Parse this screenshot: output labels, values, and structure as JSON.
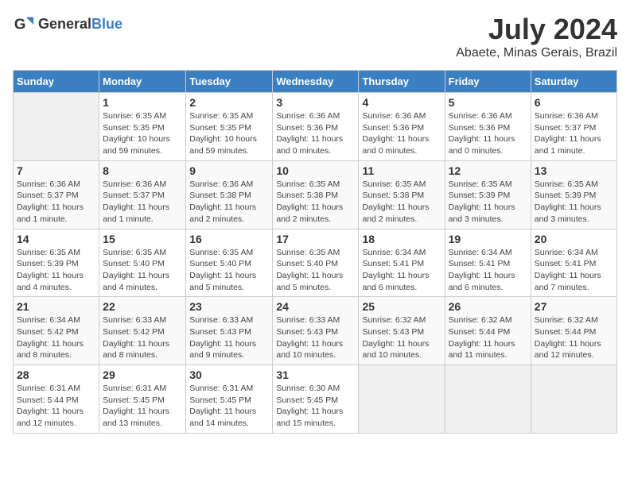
{
  "logo": {
    "general": "General",
    "blue": "Blue"
  },
  "title": "July 2024",
  "subtitle": "Abaete, Minas Gerais, Brazil",
  "headers": [
    "Sunday",
    "Monday",
    "Tuesday",
    "Wednesday",
    "Thursday",
    "Friday",
    "Saturday"
  ],
  "weeks": [
    [
      {
        "day": "",
        "info": ""
      },
      {
        "day": "1",
        "info": "Sunrise: 6:35 AM\nSunset: 5:35 PM\nDaylight: 10 hours\nand 59 minutes."
      },
      {
        "day": "2",
        "info": "Sunrise: 6:35 AM\nSunset: 5:35 PM\nDaylight: 10 hours\nand 59 minutes."
      },
      {
        "day": "3",
        "info": "Sunrise: 6:36 AM\nSunset: 5:36 PM\nDaylight: 11 hours\nand 0 minutes."
      },
      {
        "day": "4",
        "info": "Sunrise: 6:36 AM\nSunset: 5:36 PM\nDaylight: 11 hours\nand 0 minutes."
      },
      {
        "day": "5",
        "info": "Sunrise: 6:36 AM\nSunset: 5:36 PM\nDaylight: 11 hours\nand 0 minutes."
      },
      {
        "day": "6",
        "info": "Sunrise: 6:36 AM\nSunset: 5:37 PM\nDaylight: 11 hours\nand 1 minute."
      }
    ],
    [
      {
        "day": "7",
        "info": "Sunrise: 6:36 AM\nSunset: 5:37 PM\nDaylight: 11 hours\nand 1 minute."
      },
      {
        "day": "8",
        "info": "Sunrise: 6:36 AM\nSunset: 5:37 PM\nDaylight: 11 hours\nand 1 minute."
      },
      {
        "day": "9",
        "info": "Sunrise: 6:36 AM\nSunset: 5:38 PM\nDaylight: 11 hours\nand 2 minutes."
      },
      {
        "day": "10",
        "info": "Sunrise: 6:35 AM\nSunset: 5:38 PM\nDaylight: 11 hours\nand 2 minutes."
      },
      {
        "day": "11",
        "info": "Sunrise: 6:35 AM\nSunset: 5:38 PM\nDaylight: 11 hours\nand 2 minutes."
      },
      {
        "day": "12",
        "info": "Sunrise: 6:35 AM\nSunset: 5:39 PM\nDaylight: 11 hours\nand 3 minutes."
      },
      {
        "day": "13",
        "info": "Sunrise: 6:35 AM\nSunset: 5:39 PM\nDaylight: 11 hours\nand 3 minutes."
      }
    ],
    [
      {
        "day": "14",
        "info": "Sunrise: 6:35 AM\nSunset: 5:39 PM\nDaylight: 11 hours\nand 4 minutes."
      },
      {
        "day": "15",
        "info": "Sunrise: 6:35 AM\nSunset: 5:40 PM\nDaylight: 11 hours\nand 4 minutes."
      },
      {
        "day": "16",
        "info": "Sunrise: 6:35 AM\nSunset: 5:40 PM\nDaylight: 11 hours\nand 5 minutes."
      },
      {
        "day": "17",
        "info": "Sunrise: 6:35 AM\nSunset: 5:40 PM\nDaylight: 11 hours\nand 5 minutes."
      },
      {
        "day": "18",
        "info": "Sunrise: 6:34 AM\nSunset: 5:41 PM\nDaylight: 11 hours\nand 6 minutes."
      },
      {
        "day": "19",
        "info": "Sunrise: 6:34 AM\nSunset: 5:41 PM\nDaylight: 11 hours\nand 6 minutes."
      },
      {
        "day": "20",
        "info": "Sunrise: 6:34 AM\nSunset: 5:41 PM\nDaylight: 11 hours\nand 7 minutes."
      }
    ],
    [
      {
        "day": "21",
        "info": "Sunrise: 6:34 AM\nSunset: 5:42 PM\nDaylight: 11 hours\nand 8 minutes."
      },
      {
        "day": "22",
        "info": "Sunrise: 6:33 AM\nSunset: 5:42 PM\nDaylight: 11 hours\nand 8 minutes."
      },
      {
        "day": "23",
        "info": "Sunrise: 6:33 AM\nSunset: 5:43 PM\nDaylight: 11 hours\nand 9 minutes."
      },
      {
        "day": "24",
        "info": "Sunrise: 6:33 AM\nSunset: 5:43 PM\nDaylight: 11 hours\nand 10 minutes."
      },
      {
        "day": "25",
        "info": "Sunrise: 6:32 AM\nSunset: 5:43 PM\nDaylight: 11 hours\nand 10 minutes."
      },
      {
        "day": "26",
        "info": "Sunrise: 6:32 AM\nSunset: 5:44 PM\nDaylight: 11 hours\nand 11 minutes."
      },
      {
        "day": "27",
        "info": "Sunrise: 6:32 AM\nSunset: 5:44 PM\nDaylight: 11 hours\nand 12 minutes."
      }
    ],
    [
      {
        "day": "28",
        "info": "Sunrise: 6:31 AM\nSunset: 5:44 PM\nDaylight: 11 hours\nand 12 minutes."
      },
      {
        "day": "29",
        "info": "Sunrise: 6:31 AM\nSunset: 5:45 PM\nDaylight: 11 hours\nand 13 minutes."
      },
      {
        "day": "30",
        "info": "Sunrise: 6:31 AM\nSunset: 5:45 PM\nDaylight: 11 hours\nand 14 minutes."
      },
      {
        "day": "31",
        "info": "Sunrise: 6:30 AM\nSunset: 5:45 PM\nDaylight: 11 hours\nand 15 minutes."
      },
      {
        "day": "",
        "info": ""
      },
      {
        "day": "",
        "info": ""
      },
      {
        "day": "",
        "info": ""
      }
    ]
  ]
}
